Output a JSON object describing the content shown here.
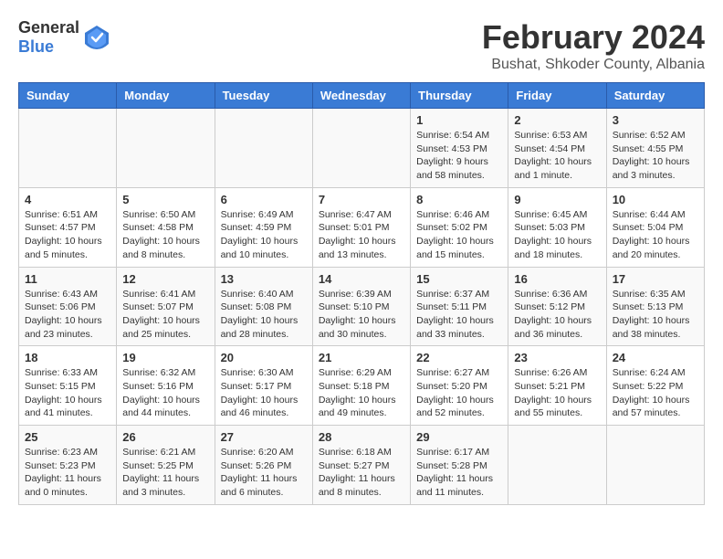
{
  "header": {
    "logo_general": "General",
    "logo_blue": "Blue",
    "title": "February 2024",
    "subtitle": "Bushat, Shkoder County, Albania"
  },
  "calendar": {
    "days_of_week": [
      "Sunday",
      "Monday",
      "Tuesday",
      "Wednesday",
      "Thursday",
      "Friday",
      "Saturday"
    ],
    "weeks": [
      [
        {
          "day": "",
          "info": ""
        },
        {
          "day": "",
          "info": ""
        },
        {
          "day": "",
          "info": ""
        },
        {
          "day": "",
          "info": ""
        },
        {
          "day": "1",
          "sunrise": "6:54 AM",
          "sunset": "4:53 PM",
          "daylight": "9 hours and 58 minutes."
        },
        {
          "day": "2",
          "sunrise": "6:53 AM",
          "sunset": "4:54 PM",
          "daylight": "10 hours and 1 minute."
        },
        {
          "day": "3",
          "sunrise": "6:52 AM",
          "sunset": "4:55 PM",
          "daylight": "10 hours and 3 minutes."
        }
      ],
      [
        {
          "day": "4",
          "sunrise": "6:51 AM",
          "sunset": "4:57 PM",
          "daylight": "10 hours and 5 minutes."
        },
        {
          "day": "5",
          "sunrise": "6:50 AM",
          "sunset": "4:58 PM",
          "daylight": "10 hours and 8 minutes."
        },
        {
          "day": "6",
          "sunrise": "6:49 AM",
          "sunset": "4:59 PM",
          "daylight": "10 hours and 10 minutes."
        },
        {
          "day": "7",
          "sunrise": "6:47 AM",
          "sunset": "5:01 PM",
          "daylight": "10 hours and 13 minutes."
        },
        {
          "day": "8",
          "sunrise": "6:46 AM",
          "sunset": "5:02 PM",
          "daylight": "10 hours and 15 minutes."
        },
        {
          "day": "9",
          "sunrise": "6:45 AM",
          "sunset": "5:03 PM",
          "daylight": "10 hours and 18 minutes."
        },
        {
          "day": "10",
          "sunrise": "6:44 AM",
          "sunset": "5:04 PM",
          "daylight": "10 hours and 20 minutes."
        }
      ],
      [
        {
          "day": "11",
          "sunrise": "6:43 AM",
          "sunset": "5:06 PM",
          "daylight": "10 hours and 23 minutes."
        },
        {
          "day": "12",
          "sunrise": "6:41 AM",
          "sunset": "5:07 PM",
          "daylight": "10 hours and 25 minutes."
        },
        {
          "day": "13",
          "sunrise": "6:40 AM",
          "sunset": "5:08 PM",
          "daylight": "10 hours and 28 minutes."
        },
        {
          "day": "14",
          "sunrise": "6:39 AM",
          "sunset": "5:10 PM",
          "daylight": "10 hours and 30 minutes."
        },
        {
          "day": "15",
          "sunrise": "6:37 AM",
          "sunset": "5:11 PM",
          "daylight": "10 hours and 33 minutes."
        },
        {
          "day": "16",
          "sunrise": "6:36 AM",
          "sunset": "5:12 PM",
          "daylight": "10 hours and 36 minutes."
        },
        {
          "day": "17",
          "sunrise": "6:35 AM",
          "sunset": "5:13 PM",
          "daylight": "10 hours and 38 minutes."
        }
      ],
      [
        {
          "day": "18",
          "sunrise": "6:33 AM",
          "sunset": "5:15 PM",
          "daylight": "10 hours and 41 minutes."
        },
        {
          "day": "19",
          "sunrise": "6:32 AM",
          "sunset": "5:16 PM",
          "daylight": "10 hours and 44 minutes."
        },
        {
          "day": "20",
          "sunrise": "6:30 AM",
          "sunset": "5:17 PM",
          "daylight": "10 hours and 46 minutes."
        },
        {
          "day": "21",
          "sunrise": "6:29 AM",
          "sunset": "5:18 PM",
          "daylight": "10 hours and 49 minutes."
        },
        {
          "day": "22",
          "sunrise": "6:27 AM",
          "sunset": "5:20 PM",
          "daylight": "10 hours and 52 minutes."
        },
        {
          "day": "23",
          "sunrise": "6:26 AM",
          "sunset": "5:21 PM",
          "daylight": "10 hours and 55 minutes."
        },
        {
          "day": "24",
          "sunrise": "6:24 AM",
          "sunset": "5:22 PM",
          "daylight": "10 hours and 57 minutes."
        }
      ],
      [
        {
          "day": "25",
          "sunrise": "6:23 AM",
          "sunset": "5:23 PM",
          "daylight": "11 hours and 0 minutes."
        },
        {
          "day": "26",
          "sunrise": "6:21 AM",
          "sunset": "5:25 PM",
          "daylight": "11 hours and 3 minutes."
        },
        {
          "day": "27",
          "sunrise": "6:20 AM",
          "sunset": "5:26 PM",
          "daylight": "11 hours and 6 minutes."
        },
        {
          "day": "28",
          "sunrise": "6:18 AM",
          "sunset": "5:27 PM",
          "daylight": "11 hours and 8 minutes."
        },
        {
          "day": "29",
          "sunrise": "6:17 AM",
          "sunset": "5:28 PM",
          "daylight": "11 hours and 11 minutes."
        },
        {
          "day": "",
          "info": ""
        },
        {
          "day": "",
          "info": ""
        }
      ]
    ]
  }
}
